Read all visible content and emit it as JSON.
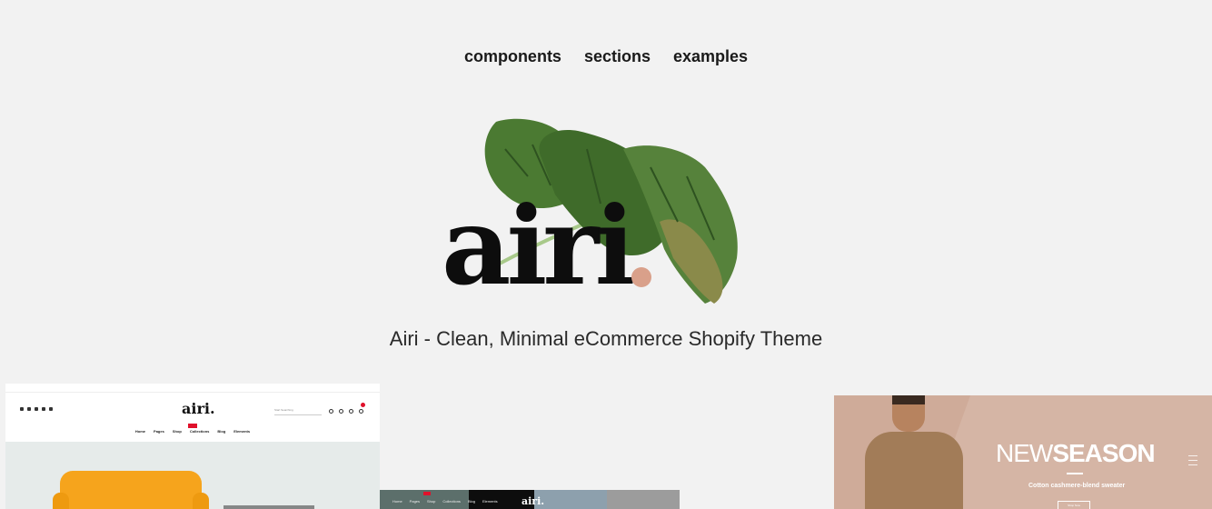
{
  "nav": {
    "items": [
      {
        "label": "components"
      },
      {
        "label": "sections"
      },
      {
        "label": "examples"
      }
    ]
  },
  "logo": {
    "text": "airi",
    "dot_color": "#d9a08a",
    "leaf_color": "#4b7a32"
  },
  "tagline": "Airi - Clean, Minimal eCommerce Shopify Theme",
  "previews": {
    "home_furniture": {
      "logo": "airi.",
      "search_placeholder": "Start Searching",
      "menu": [
        "Home",
        "Pages",
        "Shop",
        "Collections",
        "Blog",
        "Elements"
      ],
      "accent_color": "#e0112b",
      "hero_color": "#f6a41c"
    },
    "home_denim": {
      "logo": "airi.",
      "menu": [
        "Home",
        "Pages",
        "Shop",
        "Collections",
        "Blog",
        "Elements"
      ]
    },
    "home_fashion": {
      "title_light": "NEW",
      "title_bold": "SEASON",
      "subtitle": "Cotton cashmere-blend sweater",
      "button": "Shop Now",
      "bg_color": "#d5b5a5"
    }
  }
}
